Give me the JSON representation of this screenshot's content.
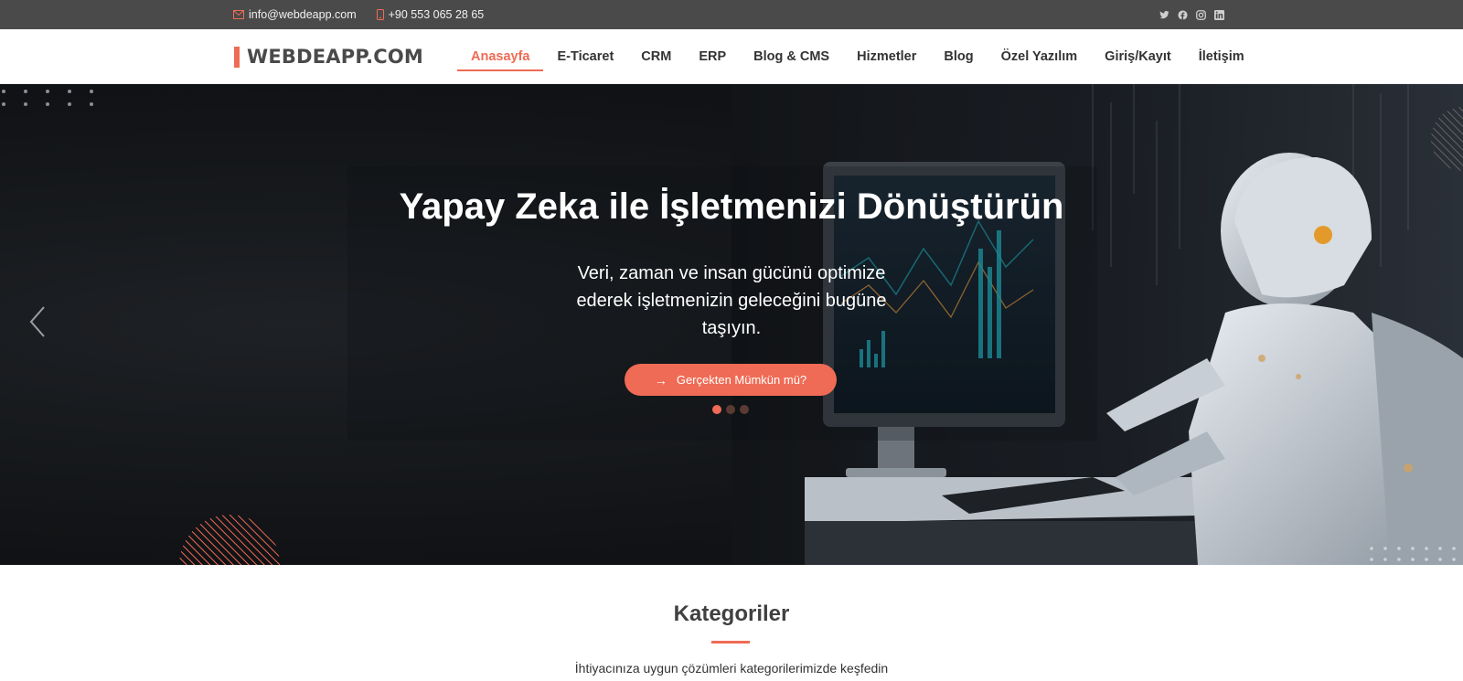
{
  "topbar": {
    "email": "info@webdeapp.com",
    "phone": "+90 553 065 28 65",
    "socials": [
      "twitter-icon",
      "facebook-icon",
      "instagram-icon",
      "linkedin-icon"
    ]
  },
  "brand": {
    "name": "WEBDEAPP.COM",
    "accent_color": "#ef6b55"
  },
  "nav": {
    "items": [
      {
        "label": "Anasayfa",
        "active": true
      },
      {
        "label": "E-Ticaret"
      },
      {
        "label": "CRM"
      },
      {
        "label": "ERP"
      },
      {
        "label": "Blog & CMS"
      },
      {
        "label": "Hizmetler"
      },
      {
        "label": "Blog"
      },
      {
        "label": "Özel Yazılım"
      },
      {
        "label": "Giriş/Kayıt"
      },
      {
        "label": "İletişim"
      }
    ]
  },
  "hero": {
    "title": "Yapay Zeka ile İşletmenizi Dönüştürün",
    "subtitle": "Veri, zaman ve insan gücünü optimize ederek işletmenizin geleceğini bugüne taşıyın.",
    "button_label": "Gerçekten Mümkün mü?",
    "slides_count": 3,
    "active_slide": 1
  },
  "categories": {
    "title": "Kategoriler",
    "subtitle": "İhtiyacınıza uygun çözümleri kategorilerimizde keşfedin"
  }
}
